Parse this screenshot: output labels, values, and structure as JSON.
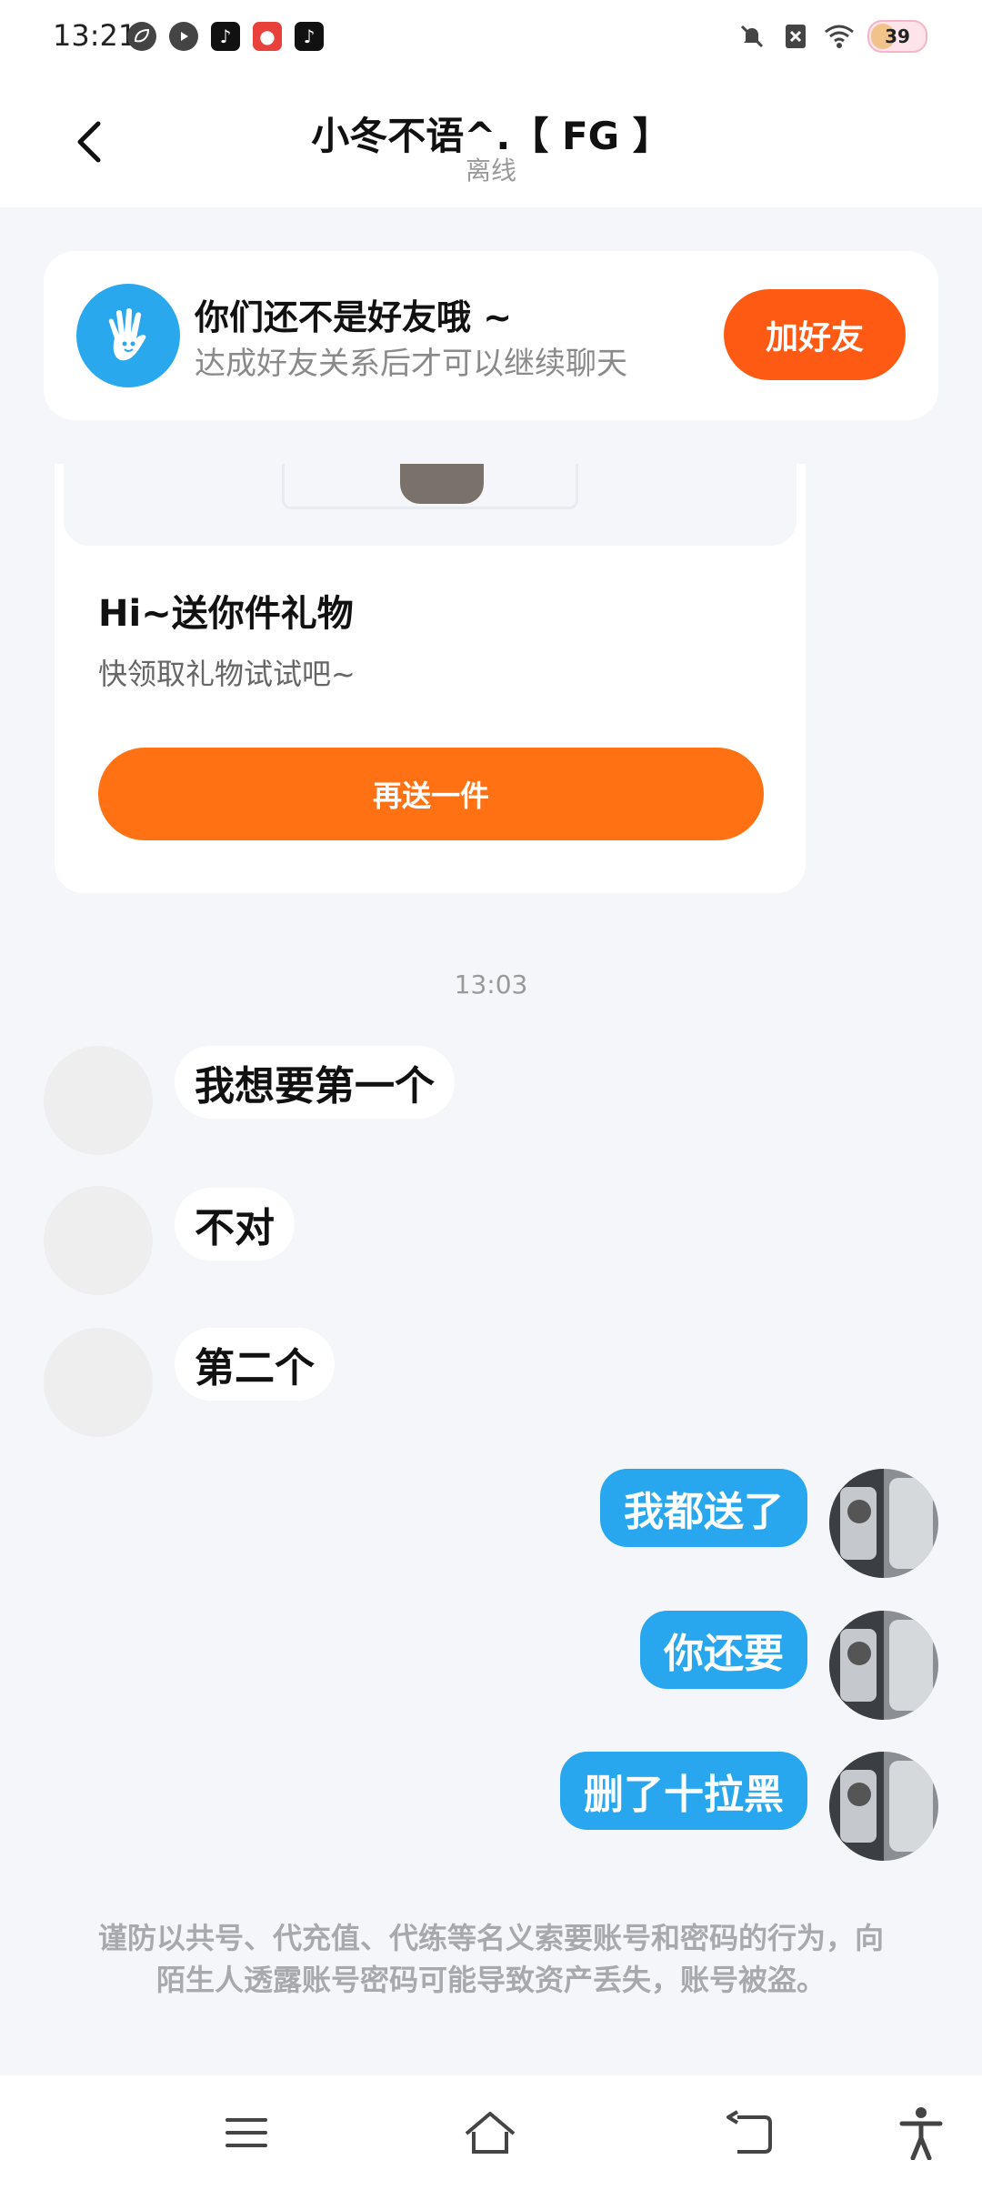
{
  "status_bar": {
    "time": "13:21",
    "battery": "39",
    "app_icons": [
      "leaf-icon",
      "video-play-icon",
      "tiktok-icon",
      "red-app-icon",
      "tiktok-lite-icon"
    ],
    "right_icons": [
      "mute-icon",
      "no-sim-icon",
      "wifi-icon",
      "battery-icon"
    ]
  },
  "header": {
    "title": "小冬不语^.【 FG 】",
    "status": "离线"
  },
  "friend_banner": {
    "title": "你们还不是好友哦 ~",
    "subtitle": "达成好友关系后才可以继续聊天",
    "button": "加好友"
  },
  "gift_card": {
    "title": "Hi~送你件礼物",
    "subtitle": "快领取礼物试试吧~",
    "button": "再送一件"
  },
  "time_separator": "13:03",
  "messages": [
    {
      "side": "in",
      "text": "我想要第一个"
    },
    {
      "side": "in",
      "text": "不对"
    },
    {
      "side": "in",
      "text": "第二个"
    },
    {
      "side": "out",
      "text": "我都送了"
    },
    {
      "side": "out",
      "text": "你还要"
    },
    {
      "side": "out",
      "text": "删了十拉黑"
    }
  ],
  "warning": "谨防以共号、代充值、代练等名义索要账号和密码的行为，向陌生人透露账号密码可能导致资产丢失，账号被盗。",
  "colors": {
    "accent_blue": "#29a7ee",
    "accent_orange": "#ff5a14",
    "background": "#f4f6f9"
  }
}
